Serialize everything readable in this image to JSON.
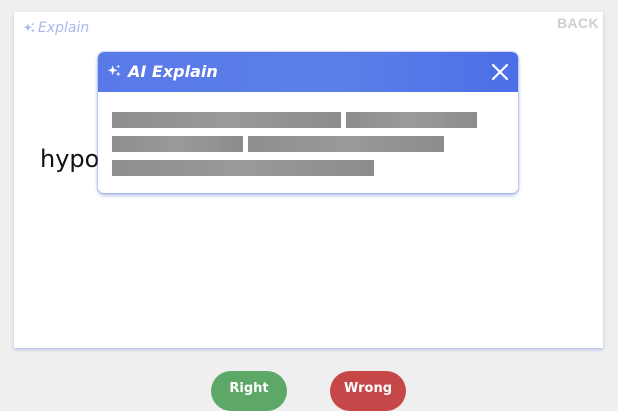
{
  "card": {
    "explain_label": "Explain",
    "back_label": "BACK",
    "term_text": "hypo distributive"
  },
  "popup": {
    "title": "AI Explain",
    "close_icon": "close-icon",
    "loading_placeholder_icon": "skeleton-loading"
  },
  "actions": {
    "right_label": "Right",
    "wrong_label": "Wrong"
  },
  "colors": {
    "background": "#efefef",
    "card": "#ffffff",
    "accent_blue": "#5b7fe8",
    "explain_link": "#a7b9ef",
    "back_link": "#cfcfcf",
    "skeleton": "#919191",
    "right_button": "#5ea867",
    "wrong_button": "#c64747"
  }
}
